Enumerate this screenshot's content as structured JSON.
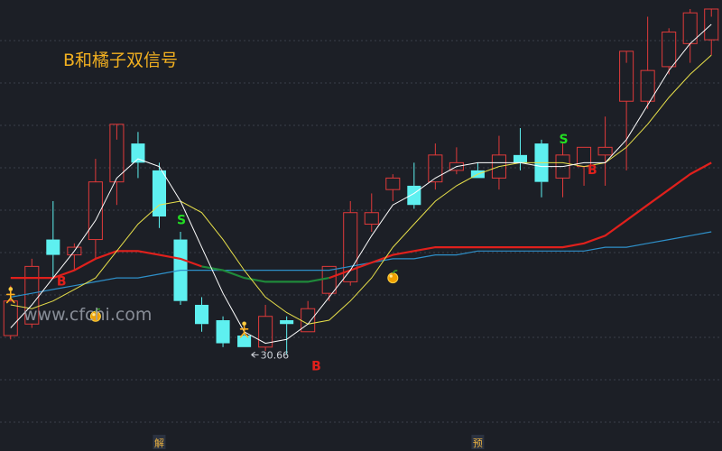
{
  "title": "B和橘子双信号",
  "watermark": "www.cfchi.com",
  "colors": {
    "background": "#1c1f26",
    "grid": "#3a3f4b",
    "up_candle": "#e03a3a",
    "down_candle": "#5ef0f0",
    "ma_fast": "#ffffff",
    "ma_mid": "#e8e04a",
    "ma_slow_red": "#e0201c",
    "ma_slow_green": "#1f8a3a",
    "ma_long": "#2e8fc8",
    "signal_b": "#e0201c",
    "signal_s": "#22dd22",
    "title": "#f2b020"
  },
  "chart_data": {
    "type": "candlestick",
    "title": "B和橘子双信号",
    "y_unit": "price",
    "ylim": [
      28.2,
      39.0
    ],
    "grid": "horizontal",
    "candles": [
      {
        "o": 30.5,
        "h": 31.8,
        "l": 30.4,
        "c": 31.4
      },
      {
        "o": 30.8,
        "h": 32.5,
        "l": 30.7,
        "c": 32.3
      },
      {
        "o": 33.0,
        "h": 34.0,
        "l": 32.0,
        "c": 32.6
      },
      {
        "o": 32.6,
        "h": 32.9,
        "l": 32.2,
        "c": 32.8
      },
      {
        "o": 33.0,
        "h": 35.1,
        "l": 32.5,
        "c": 34.5
      },
      {
        "o": 34.5,
        "h": 35.6,
        "l": 33.9,
        "c": 36.0
      },
      {
        "o": 35.5,
        "h": 35.8,
        "l": 34.6,
        "c": 35.0
      },
      {
        "o": 34.8,
        "h": 35.0,
        "l": 33.3,
        "c": 33.6
      },
      {
        "o": 33.0,
        "h": 33.2,
        "l": 31.3,
        "c": 31.4
      },
      {
        "o": 31.3,
        "h": 31.5,
        "l": 30.6,
        "c": 30.8
      },
      {
        "o": 30.9,
        "h": 31.0,
        "l": 30.2,
        "c": 30.3
      },
      {
        "o": 30.5,
        "h": 30.7,
        "l": 30.2,
        "c": 30.2
      },
      {
        "o": 30.2,
        "h": 31.3,
        "l": 30.1,
        "c": 31.0
      },
      {
        "o": 30.9,
        "h": 31.0,
        "l": 30.0,
        "c": 30.8
      },
      {
        "o": 30.6,
        "h": 31.4,
        "l": 30.6,
        "c": 31.2
      },
      {
        "o": 31.6,
        "h": 32.3,
        "l": 31.4,
        "c": 32.3
      },
      {
        "o": 31.9,
        "h": 34.0,
        "l": 31.8,
        "c": 33.7
      },
      {
        "o": 33.4,
        "h": 34.2,
        "l": 33.2,
        "c": 33.7
      },
      {
        "o": 34.3,
        "h": 34.7,
        "l": 34.0,
        "c": 34.6
      },
      {
        "o": 34.4,
        "h": 35.0,
        "l": 33.8,
        "c": 33.9
      },
      {
        "o": 34.5,
        "h": 35.5,
        "l": 34.3,
        "c": 35.2
      },
      {
        "o": 34.8,
        "h": 35.4,
        "l": 34.7,
        "c": 35.0
      },
      {
        "o": 34.8,
        "h": 35.0,
        "l": 34.6,
        "c": 34.6
      },
      {
        "o": 34.6,
        "h": 35.7,
        "l": 34.3,
        "c": 35.2
      },
      {
        "o": 35.2,
        "h": 35.9,
        "l": 34.8,
        "c": 35.0
      },
      {
        "o": 35.5,
        "h": 35.6,
        "l": 34.1,
        "c": 34.5
      },
      {
        "o": 34.6,
        "h": 35.5,
        "l": 34.1,
        "c": 35.2
      },
      {
        "o": 34.9,
        "h": 35.4,
        "l": 34.4,
        "c": 35.4
      },
      {
        "o": 35.2,
        "h": 36.2,
        "l": 34.4,
        "c": 35.4
      },
      {
        "o": 36.6,
        "h": 37.6,
        "l": 34.8,
        "c": 37.9
      },
      {
        "o": 36.6,
        "h": 38.8,
        "l": 36.4,
        "c": 37.4
      },
      {
        "o": 37.5,
        "h": 38.5,
        "l": 37.3,
        "c": 38.4
      },
      {
        "o": 38.1,
        "h": 39.0,
        "l": 37.6,
        "c": 38.9
      },
      {
        "o": 38.2,
        "h": 38.8,
        "l": 37.8,
        "c": 39.0
      }
    ],
    "ma_fast": [
      30.7,
      31.3,
      32.0,
      32.7,
      33.5,
      34.6,
      35.1,
      34.9,
      34.0,
      32.8,
      31.6,
      30.6,
      30.3,
      30.4,
      30.8,
      31.5,
      32.2,
      33.1,
      33.9,
      34.2,
      34.6,
      34.9,
      35.0,
      35.0,
      35.0,
      34.9,
      34.9,
      35.0,
      35.0,
      35.6,
      36.5,
      37.4,
      38.1,
      38.6
    ],
    "ma_mid": [
      31.3,
      31.2,
      31.4,
      31.7,
      32.0,
      32.7,
      33.4,
      33.9,
      34.0,
      33.7,
      33.0,
      32.2,
      31.5,
      31.1,
      30.8,
      30.9,
      31.4,
      32.0,
      32.8,
      33.4,
      34.0,
      34.4,
      34.7,
      34.9,
      35.0,
      35.0,
      35.0,
      34.9,
      35.0,
      35.4,
      36.0,
      36.7,
      37.3,
      37.8
    ],
    "ma_slow": [
      32.0,
      32.0,
      32.0,
      32.2,
      32.5,
      32.7,
      32.7,
      32.6,
      32.5,
      32.3,
      32.2,
      32.0,
      31.9,
      31.9,
      31.9,
      32.0,
      32.2,
      32.4,
      32.6,
      32.7,
      32.8,
      32.8,
      32.8,
      32.8,
      32.8,
      32.8,
      32.8,
      32.9,
      33.1,
      33.5,
      33.9,
      34.3,
      34.7,
      35.0
    ],
    "ma_long": [
      31.5,
      31.6,
      31.7,
      31.8,
      31.9,
      32.0,
      32.0,
      32.1,
      32.2,
      32.2,
      32.2,
      32.2,
      32.2,
      32.2,
      32.2,
      32.2,
      32.3,
      32.4,
      32.5,
      32.5,
      32.6,
      32.6,
      32.7,
      32.7,
      32.7,
      32.7,
      32.7,
      32.7,
      32.8,
      32.8,
      32.9,
      33.0,
      33.1,
      33.2
    ],
    "ma_slow_green_range": [
      9,
      15
    ],
    "signals": [
      {
        "type": "B",
        "bar": 2,
        "price": 31.8
      },
      {
        "type": "orange",
        "bar": 4,
        "price": 31.0
      },
      {
        "type": "figure",
        "bar": 0,
        "price": 31.5
      },
      {
        "type": "S",
        "bar": 8,
        "price": 33.4
      },
      {
        "type": "figure",
        "bar": 11,
        "price": 30.6
      },
      {
        "type": "B",
        "bar": 14,
        "price": 29.6
      },
      {
        "type": "orange",
        "bar": 18,
        "price": 32.0
      },
      {
        "type": "S",
        "bar": 26,
        "price": 35.5
      },
      {
        "type": "B",
        "bar": 27,
        "price": 34.7
      }
    ],
    "low_annotation": {
      "bar": 11,
      "price": 30.0,
      "label": "30.66"
    },
    "bottom_markers": [
      {
        "bar": 7,
        "label": "解"
      },
      {
        "bar": 22,
        "label": "预"
      }
    ]
  }
}
